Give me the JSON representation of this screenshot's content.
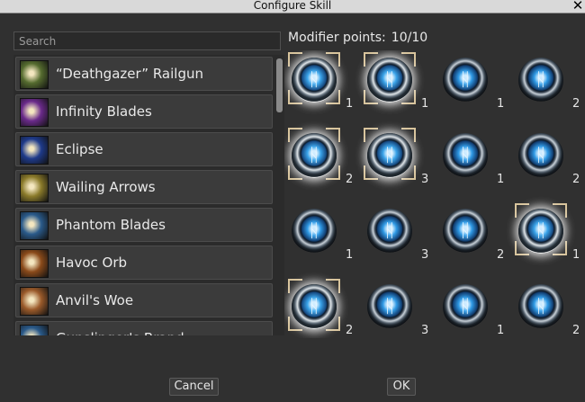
{
  "window": {
    "title": "Configure Skill"
  },
  "search": {
    "placeholder": "Search"
  },
  "skills": [
    {
      "label": "“Deathgazer” Railgun",
      "icon": "railgun-icon",
      "color": "#556b2f"
    },
    {
      "label": "Infinity Blades",
      "icon": "blades-icon",
      "color": "#6a2a8a"
    },
    {
      "label": "Eclipse",
      "icon": "eclipse-icon",
      "color": "#1e3a8a"
    },
    {
      "label": "Wailing Arrows",
      "icon": "arrows-icon",
      "color": "#8a7a2a"
    },
    {
      "label": "Phantom Blades",
      "icon": "phantom-icon",
      "color": "#2a5a8a"
    },
    {
      "label": "Havoc Orb",
      "icon": "orb-icon",
      "color": "#8a4a1a"
    },
    {
      "label": "Anvil's Woe",
      "icon": "anvil-icon",
      "color": "#9a5a2a"
    },
    {
      "label": "Gunslinger's Brand",
      "icon": "brand-icon",
      "color": "#2a5a8a"
    }
  ],
  "modifier_points": {
    "label": "Modifier points:",
    "value": "10/10"
  },
  "modifiers": [
    {
      "cost": "1",
      "selected": true
    },
    {
      "cost": "1",
      "selected": true
    },
    {
      "cost": "1",
      "selected": false
    },
    {
      "cost": "2",
      "selected": false
    },
    {
      "cost": "2",
      "selected": true
    },
    {
      "cost": "3",
      "selected": true
    },
    {
      "cost": "1",
      "selected": false
    },
    {
      "cost": "2",
      "selected": false
    },
    {
      "cost": "1",
      "selected": false
    },
    {
      "cost": "3",
      "selected": false
    },
    {
      "cost": "2",
      "selected": false
    },
    {
      "cost": "1",
      "selected": true
    },
    {
      "cost": "2",
      "selected": true
    },
    {
      "cost": "3",
      "selected": false
    },
    {
      "cost": "1",
      "selected": false
    },
    {
      "cost": "2",
      "selected": false
    }
  ],
  "buttons": {
    "cancel": "Cancel",
    "ok": "OK"
  }
}
